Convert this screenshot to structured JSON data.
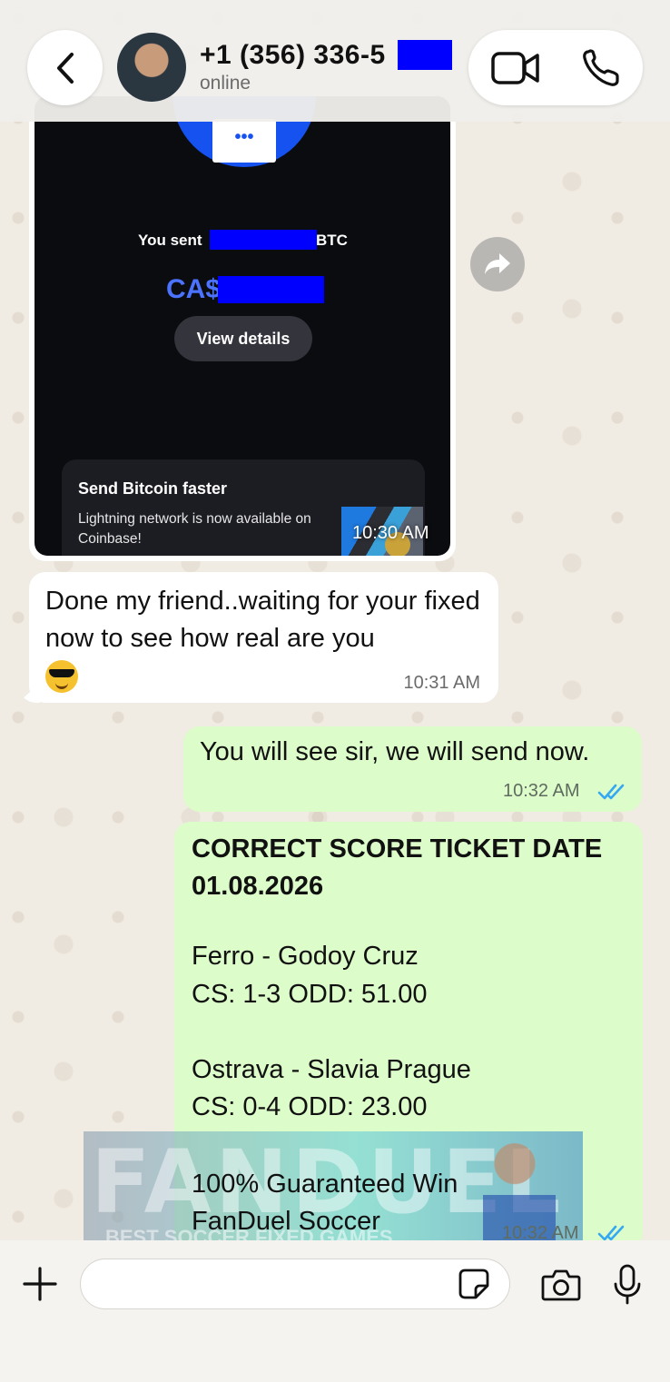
{
  "header": {
    "contact_name": "+1 (356) 336-5",
    "status": "online"
  },
  "messages": {
    "image_message": {
      "sent_prefix": "You sent",
      "sent_suffix": "BTC",
      "amount_currency": "CA$",
      "view_details_label": "View details",
      "promo_title": "Send Bitcoin faster",
      "promo_body": "Lightning network is now available on Coinbase!",
      "time": "10:30 AM"
    },
    "incoming_text": {
      "text": "Done my friend..waiting for your fixed now to see how real are you",
      "time": "10:31 AM"
    },
    "outgoing_1": {
      "text": "You will see sir, we will send now.",
      "time": "10:32 AM"
    },
    "outgoing_2": {
      "title": "CORRECT SCORE TICKET DATE 01.08.2026",
      "match1": "Ferro - Godoy Cruz",
      "match1_odds": "CS: 1-3  ODD: 51.00",
      "match2": "Ostrava - Slavia Prague",
      "match2_odds": "CS: 0-4  ODD: 23.00",
      "footer1": "100% Guaranteed Win",
      "footer2": "FanDuel Soccer",
      "time": "10:32 AM"
    }
  },
  "watermark": {
    "brand": "FANDUEL",
    "tagline": "BEST SOCCER FIXED GAMES"
  },
  "composer": {
    "input_value": ""
  },
  "colors": {
    "outgoing_bubble": "#dcfcc9",
    "incoming_bubble": "#ffffff",
    "read_tick": "#34a8f2",
    "redaction": "#0000ff",
    "coinbase_blue": "#1652f0"
  },
  "icons": [
    "back-icon",
    "video-call-icon",
    "phone-icon",
    "forward-icon",
    "plus-icon",
    "sticker-icon",
    "camera-icon",
    "microphone-icon",
    "read-ticks-icon"
  ]
}
